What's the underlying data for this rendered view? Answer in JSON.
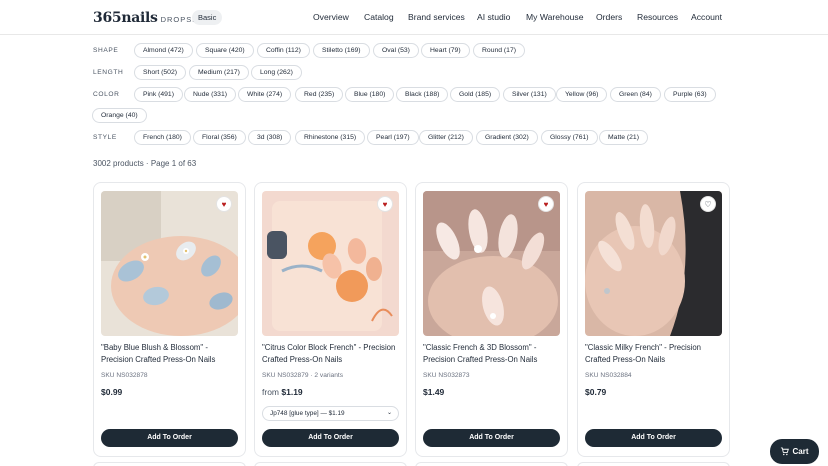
{
  "header": {
    "logo_main": "365nails",
    "logo_sub": "DROPSHIP",
    "plan_badge": "Basic",
    "nav": [
      "Overview",
      "Catalog",
      "Brand services",
      "AI studio",
      "My Warehouse",
      "Orders",
      "Resources",
      "Account"
    ]
  },
  "filters": {
    "shape": {
      "label": "SHAPE",
      "chips": [
        "Almond (472)",
        "Square (420)",
        "Coffin (112)",
        "Stiletto (169)",
        "Oval (53)",
        "Heart (79)",
        "Round (17)"
      ]
    },
    "length": {
      "label": "LENGTH",
      "chips": [
        "Short (502)",
        "Medium (217)",
        "Long (262)"
      ]
    },
    "color": {
      "label": "COLOR",
      "chips": [
        "Pink (491)",
        "Nude (331)",
        "White (274)",
        "Red (235)",
        "Blue (180)",
        "Black (188)",
        "Gold (185)",
        "Silver (131)",
        "Yellow (96)",
        "Green (84)",
        "Purple (63)",
        "Orange (40)"
      ]
    },
    "style": {
      "label": "STYLE",
      "chips": [
        "French (180)",
        "Floral (356)",
        "3d (308)",
        "Rhinestone (315)",
        "Pearl (197)",
        "Glitter (212)",
        "Gradient (302)",
        "Glossy (761)",
        "Matte (21)"
      ]
    }
  },
  "results": {
    "summary": "3002 products · Page 1 of 63"
  },
  "products": [
    {
      "title": "\"Baby Blue Blush & Blossom\" - Precision Crafted Press-On Nails",
      "sku": "SKU NS032878",
      "price": "$0.99",
      "favorited": true,
      "add_label": "Add To Order"
    },
    {
      "title": "\"Citrus Color Block French\" - Precision Crafted Press-On Nails",
      "sku": "SKU NS032879 · 2 variants",
      "price_prefix": "from",
      "price": "$1.19",
      "variant_selected": "Jp748 [glue type] — $1.19",
      "favorited": true,
      "add_label": "Add To Order"
    },
    {
      "title": "\"Classic French & 3D Blossom\" - Precision Crafted Press-On Nails",
      "sku": "SKU NS032873",
      "price": "$1.49",
      "favorited": true,
      "add_label": "Add To Order"
    },
    {
      "title": "\"Classic Milky French\" - Precision Crafted Press-On Nails",
      "sku": "SKU NS032884",
      "price": "$0.79",
      "favorited": false,
      "add_label": "Add To Order"
    }
  ],
  "cart": {
    "label": "Cart"
  },
  "colors": {
    "accent_dark": "#1e2a35",
    "favorite_red": "#b91c1c",
    "chip_border": "#d9dde2"
  }
}
